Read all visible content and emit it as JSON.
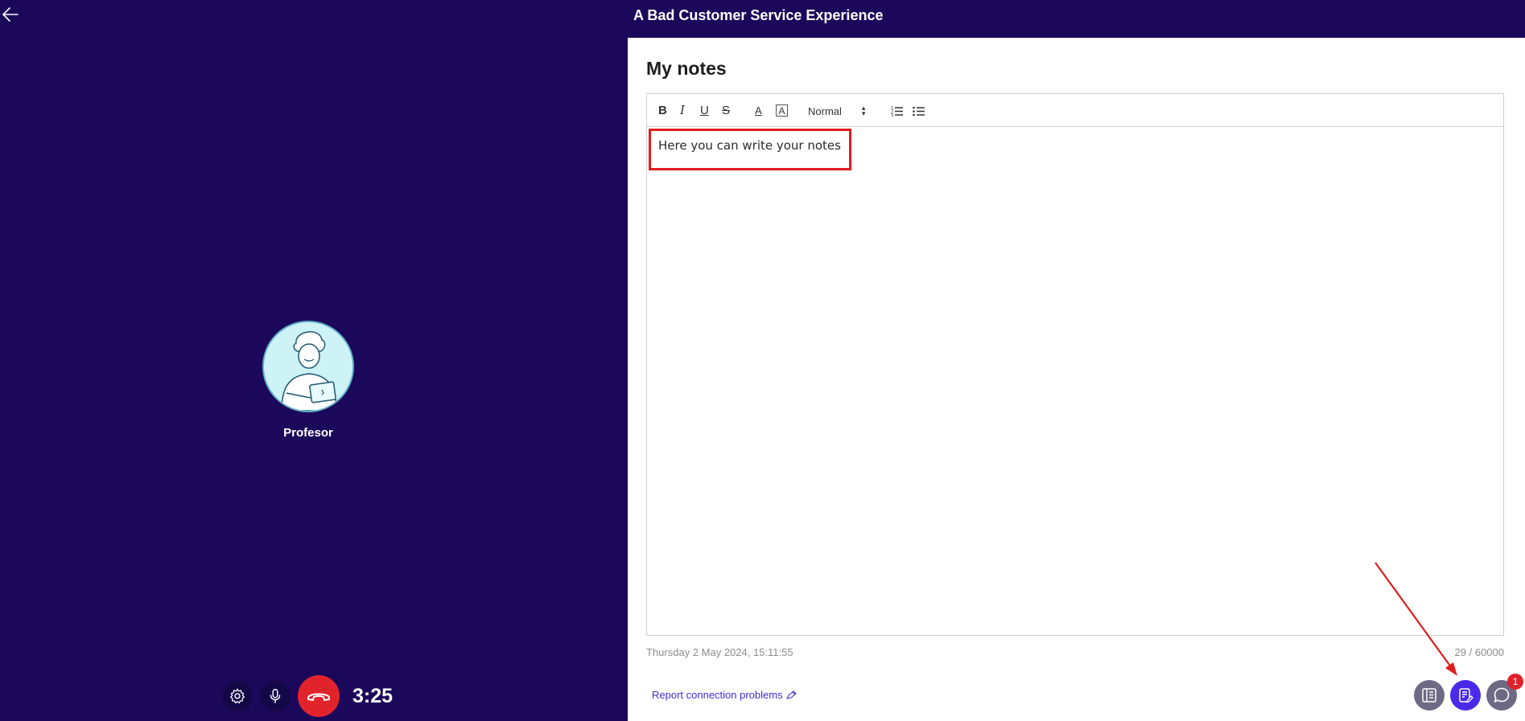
{
  "call": {
    "title": "A Bad Customer Service Experience",
    "timer": "3:25",
    "participant": {
      "name": "Profesor"
    }
  },
  "controls": {
    "icons": [
      "gear-icon",
      "microphone-icon",
      "hang-up-icon"
    ],
    "hangup_color": "#e1242c"
  },
  "notes": {
    "heading": "My notes",
    "toolbar": {
      "bold": "B",
      "italic": "I",
      "underline": "U",
      "strike": "S",
      "text_color": "A",
      "background_color": "A",
      "size_value": "Normal"
    },
    "content": "Here you can write your notes",
    "date": "Thursday 2 May 2024, 15:11:55",
    "char_count": "29 / 60000"
  },
  "footer": {
    "report_link": "Report connection problems"
  },
  "panel_tabs": {
    "tabs": [
      "book-icon",
      "notes-icon",
      "chat-icon"
    ],
    "active": "notes-icon",
    "chat_badge": "1"
  },
  "colors": {
    "background": "#1b085a",
    "accent": "#4a2ae8",
    "annotation": "#e01d1d"
  }
}
